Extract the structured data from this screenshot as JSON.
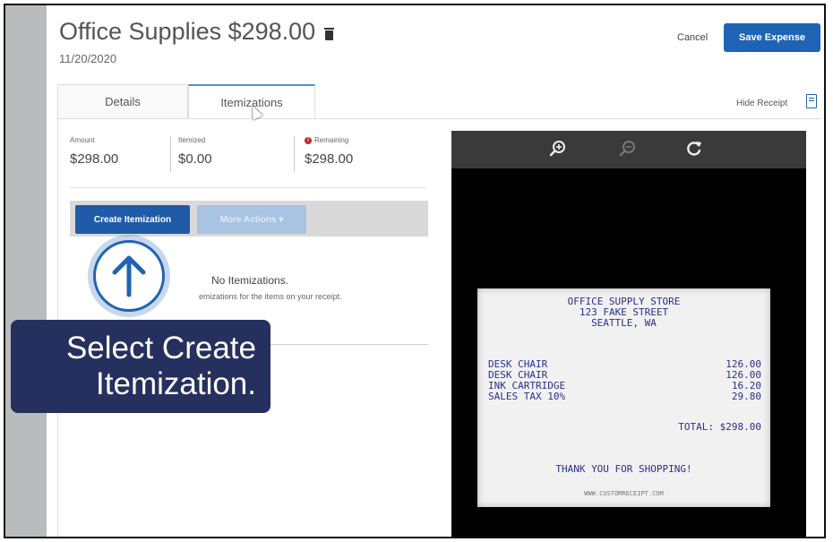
{
  "header": {
    "title": "Office Supplies $298.00",
    "date": "11/20/2020",
    "cancel_label": "Cancel",
    "save_label": "Save Expense"
  },
  "tabs": [
    {
      "label": "Details",
      "active": false
    },
    {
      "label": "Itemizations",
      "active": true
    }
  ],
  "hide_receipt_label": "Hide Receipt",
  "stats": [
    {
      "label": "Amount",
      "value": "$298.00"
    },
    {
      "label": "Itemized",
      "value": "$0.00"
    },
    {
      "label": "Remaining",
      "value": "$298.00",
      "alert": "!"
    }
  ],
  "toolbar": {
    "create_label": "Create Itemization",
    "more_label": "More Actions ▾"
  },
  "empty_state": {
    "title": "No Itemizations.",
    "subtitle": "emizations for the items on your receipt."
  },
  "callout": {
    "line1": "Select Create",
    "line2": "Itemization."
  },
  "receipt_viewer": {
    "tools": [
      "zoom-in-icon",
      "zoom-out-icon",
      "rotate-icon"
    ],
    "receipt": {
      "store": "OFFICE SUPPLY STORE",
      "street": "123 FAKE STREET",
      "city": "SEATTLE, WA",
      "items": [
        {
          "name": "DESK CHAIR",
          "price": "126.00"
        },
        {
          "name": "DESK CHAIR",
          "price": "126.00"
        },
        {
          "name": "INK CARTRIDGE",
          "price": "16.20"
        },
        {
          "name": "SALES TAX 10%",
          "price": "29.80"
        }
      ],
      "total": "TOTAL: $298.00",
      "thanks": "THANK YOU FOR SHOPPING!",
      "url": "WWW.CUSTOMRECEIPT.COM"
    }
  },
  "colors": {
    "primary": "#1f63b4",
    "callout_bg": "#26305f",
    "alert": "#c0282d",
    "receipt_ink": "#2a2f8f"
  }
}
